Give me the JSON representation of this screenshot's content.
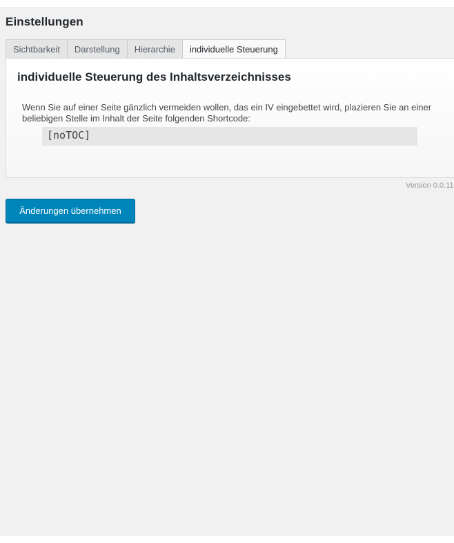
{
  "header": {
    "title": "Einstellungen"
  },
  "tabs": [
    {
      "label": "Sichtbarkeit",
      "active": false
    },
    {
      "label": "Darstellung",
      "active": false
    },
    {
      "label": "Hierarchie",
      "active": false
    },
    {
      "label": "individuelle Steuerung",
      "active": true
    }
  ],
  "panel": {
    "heading": "individuelle Steuerung des Inhaltsverzeichnisses",
    "description": "Wenn Sie auf einer Seite gänzlich vermeiden wollen, das ein IV eingebettet wird, plazieren Sie an einer beliebigen Stelle im Inhalt der Seite folgenden Shortcode:",
    "shortcode": "[noTOC]"
  },
  "footer": {
    "version": "Version 0.0.11",
    "submit_label": "Änderungen übernehmen"
  },
  "colors": {
    "background": "#f1f1f1",
    "primary_button": "#0085ba"
  }
}
